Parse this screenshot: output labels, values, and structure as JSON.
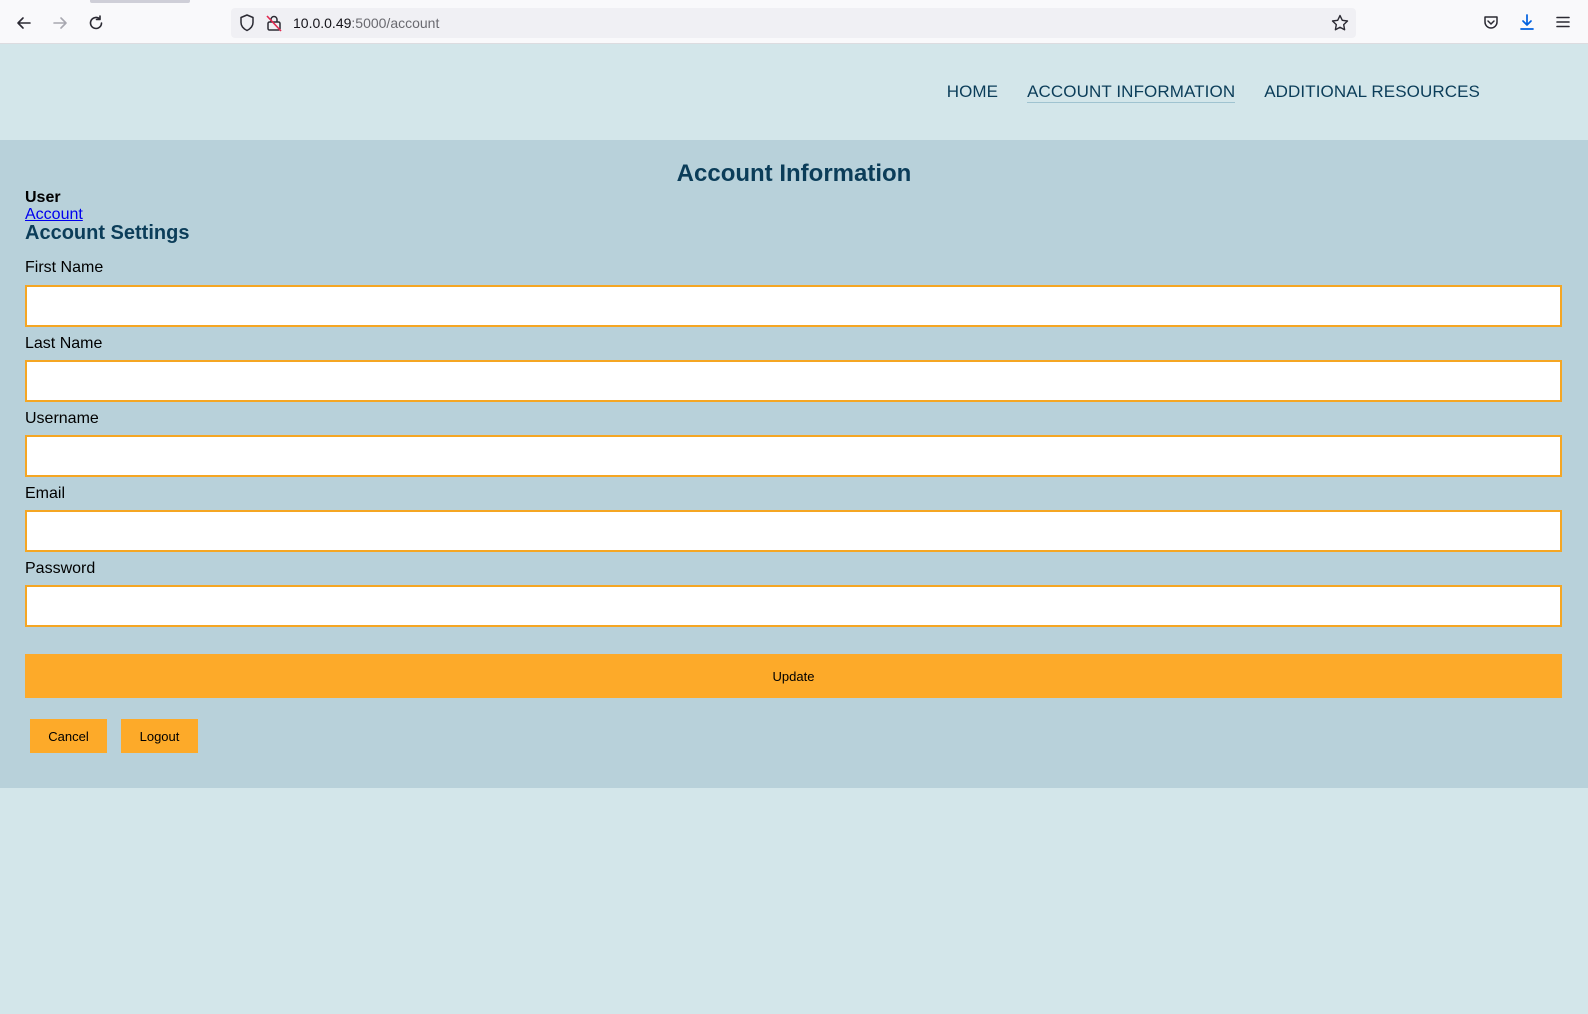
{
  "browser": {
    "url_host": "10.0.0.49",
    "url_path": ":5000/account",
    "icons": [
      "back-arrow-icon",
      "forward-arrow-icon",
      "reload-icon",
      "shield-icon",
      "insecure-lock-icon",
      "bookmark-star-icon",
      "pocket-icon",
      "download-icon",
      "menu-icon"
    ],
    "colors": {
      "download_icon": "#0060df"
    }
  },
  "nav": {
    "home": "HOME",
    "account_information": "ACCOUNT INFORMATION",
    "additional_resources": "ADDITIONAL RESOURCES"
  },
  "page": {
    "title": "Account Information",
    "user_label": "User",
    "account_link": "Account",
    "settings_title": "Account Settings"
  },
  "form": {
    "first_name_label": "First Name",
    "first_name_value": "",
    "last_name_label": "Last Name",
    "last_name_value": "",
    "username_label": "Username",
    "username_value": "",
    "email_label": "Email",
    "email_value": "",
    "password_label": "Password",
    "password_value": "",
    "update_label": "Update",
    "cancel_label": "Cancel",
    "logout_label": "Logout"
  },
  "colors": {
    "header_bg": "#d3e6ea",
    "panel_bg": "#b8d1da",
    "accent": "#fdaa29",
    "input_border": "#f5a623",
    "heading_text": "#0b3d59",
    "link": "#0000ee"
  }
}
